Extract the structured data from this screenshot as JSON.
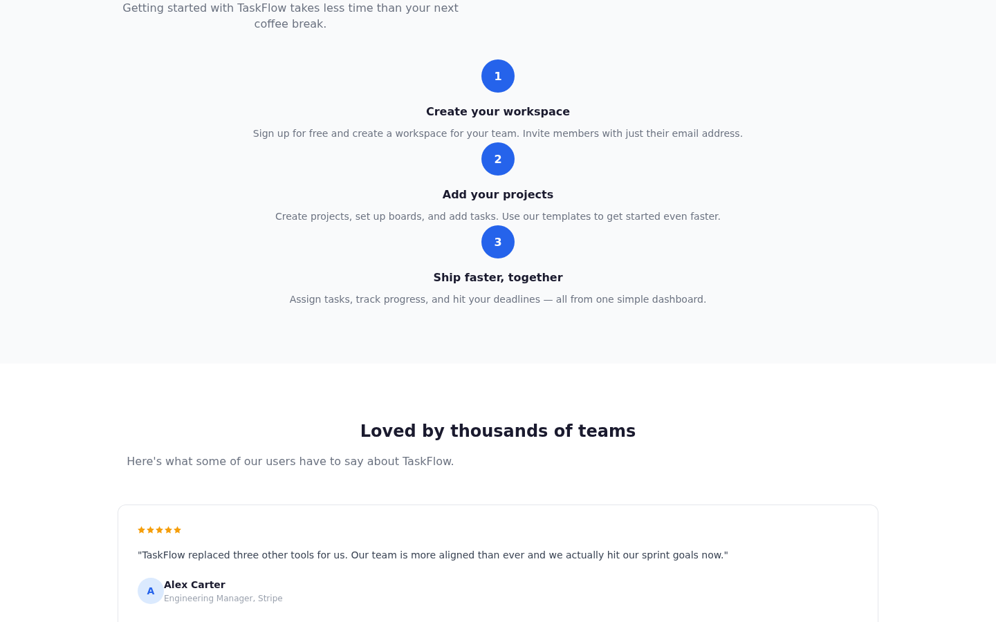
{
  "intro": {
    "text": "Getting started with TaskFlow takes less time than your next coffee break."
  },
  "steps": [
    {
      "number": "1",
      "title": "Create your workspace",
      "description": "Sign up for free and create a workspace for your team. Invite members with just their email address."
    },
    {
      "number": "2",
      "title": "Add your projects",
      "description": "Create projects, set up boards, and add tasks. Use our templates to get started even faster."
    },
    {
      "number": "3",
      "title": "Ship faster, together",
      "description": "Assign tasks, track progress, and hit your deadlines — all from one simple dashboard."
    }
  ],
  "testimonials_section": {
    "heading": "Loved by thousands of teams",
    "subtitle": "Here's what some of our users have to say about TaskFlow."
  },
  "testimonials": [
    {
      "stars": 5,
      "quote": "\"TaskFlow replaced three other tools for us. Our team is more aligned than ever and we actually hit our sprint goals now.\"",
      "initial": "A",
      "name": "Alex Carter",
      "role": "Engineering Manager, Stripe"
    }
  ]
}
